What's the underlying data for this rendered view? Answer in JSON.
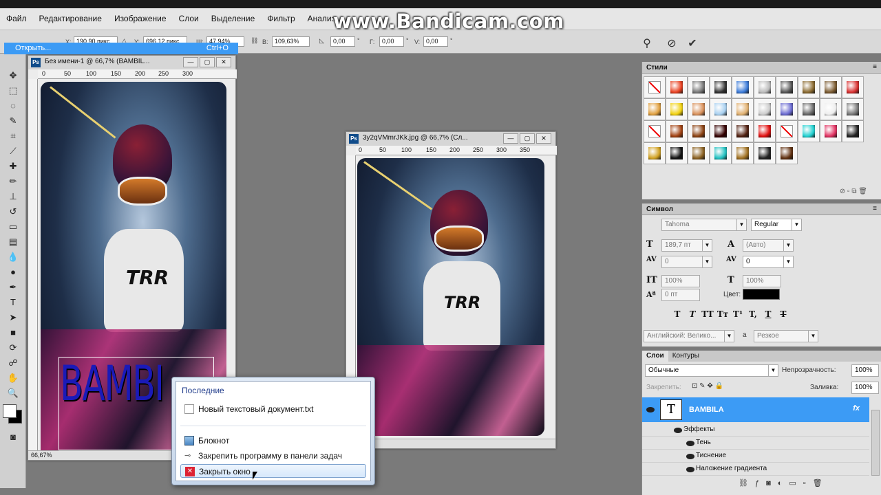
{
  "watermark": "www.Bandicam.com",
  "menu": [
    "Файл",
    "Редактирование",
    "Изображение",
    "Слои",
    "Выделение",
    "Фильтр",
    "Анализ"
  ],
  "options": {
    "x_label": "X:",
    "x_value": "190,90 пикс",
    "y_label": "Y:",
    "y_value": "696,12 пикс",
    "w_label": "Ш:",
    "w_value": "47,94%",
    "h_label": "В:",
    "h_value": "109,63%",
    "angle_value": "0,00",
    "h_skew_label": "Г:",
    "h_skew_value": "0,00",
    "v_skew_label": "V:",
    "v_skew_value": "0,00",
    "degree": "°"
  },
  "open_row": {
    "label": "Открыть...",
    "shortcut": "Ctrl+O"
  },
  "doc1": {
    "title": "Без имени-1 @ 66,7% (BAMBIL...",
    "ruler": [
      "0",
      "50",
      "100",
      "150",
      "200",
      "250",
      "300"
    ],
    "zoom": "66,67%",
    "text_layer": "BAMBI"
  },
  "doc2": {
    "title": "3y2qVMmrJKk.jpg @ 66,7% (Сл...",
    "ruler": [
      "0",
      "50",
      "100",
      "150",
      "200",
      "250",
      "300",
      "350"
    ]
  },
  "shirt_logo": "TRR",
  "styles_panel": {
    "title": "Стили"
  },
  "symbol_panel": {
    "title": "Символ",
    "font": "Tahoma",
    "style": "Regular",
    "size": "189,7 пт",
    "leading": "(Авто)",
    "kerning": "0",
    "tracking": "0",
    "vscale": "100%",
    "hscale": "100%",
    "baseline": "0 пт",
    "color_label": "Цвет:",
    "color": "#000000",
    "language": "Английский: Велико...",
    "aa_label": "а",
    "aa_value": "Резкое",
    "glyphs": [
      "T",
      "T",
      "TT",
      "Tт",
      "T¹",
      "T,",
      "T",
      "T"
    ]
  },
  "layers_panel": {
    "tab_layers": "Слои",
    "tab_paths": "Контуры",
    "blend": "Обычные",
    "opacity_label": "Непрозрачность:",
    "opacity": "100%",
    "lock_label": "Закрепить:",
    "fill_label": "Заливка:",
    "fill": "100%",
    "layer_name": "BAMBILA",
    "fx": "fx",
    "effects_label": "Эффекты",
    "effects": [
      "Тень",
      "Тиснение",
      "Наложение градиента"
    ]
  },
  "context_menu": {
    "header": "Последние",
    "recent": "Новый текстовый документ.txt",
    "items": [
      "Блокнот",
      "Закрепить программу в панели задач",
      "Закрыть окно"
    ]
  }
}
